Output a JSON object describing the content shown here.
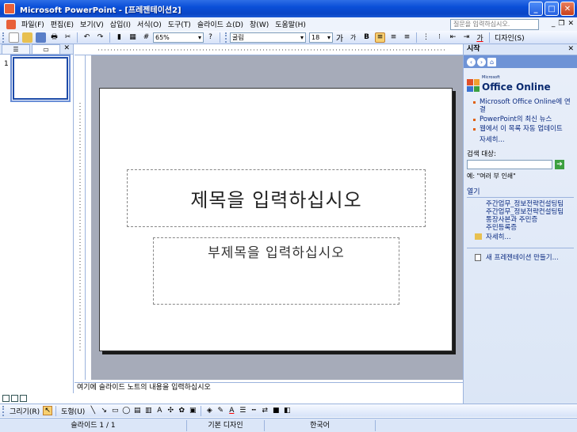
{
  "window": {
    "title": "Microsoft PowerPoint - [프레젠테이션2]"
  },
  "menu": {
    "items": [
      "파일(F)",
      "편집(E)",
      "보기(V)",
      "삽입(I)",
      "서식(O)",
      "도구(T)",
      "슬라이드 쇼(D)",
      "창(W)",
      "도움말(H)"
    ],
    "help_placeholder": "질문을 입력하십시오."
  },
  "toolbar": {
    "zoom": "65%",
    "font": "굴림",
    "font_size": "18",
    "design_label": "디자인(S)",
    "grow_font": "가",
    "shrink_font": "가",
    "font_color_glyph": "가"
  },
  "slides_pane": {
    "slide_number": "1"
  },
  "slide": {
    "title_placeholder": "제목을 입력하십시오",
    "subtitle_placeholder": "부제목을 입력하십시오"
  },
  "notes": {
    "placeholder": "여기에 슬라이드 노트의 내용을 입력하십시오"
  },
  "task_pane": {
    "title": "시작",
    "logo_top": "Microsoft",
    "logo_main": "Office Online",
    "links": [
      "Microsoft Office Online에 연결",
      "PowerPoint의 최신 뉴스",
      "웹에서 이 목록 자동 업데이트"
    ],
    "more": "자세히...",
    "search_label": "검색 대상:",
    "search_example": "예: \"여러 부 인쇄\"",
    "open_header": "열기",
    "recent_files": [
      "주간업무_정보전략컨설팅팀",
      "주간업무_정보전략컨설팅팀",
      "통장사본과 주민증",
      "주민등록증"
    ],
    "files_more": "자세히...",
    "new_presentation": "새 프레젠테이션 만들기..."
  },
  "draw_toolbar": {
    "draw_label": "그리기(R)",
    "autoshape_label": "도형(U)"
  },
  "status": {
    "slide_info": "슬라이드 1 / 1",
    "design": "기본 디자인",
    "language": "한국어"
  },
  "colors": {
    "title_bar": "#0a4fd8",
    "pane_bg": "#dbe6f8",
    "canvas_bg": "#a6abb9"
  }
}
